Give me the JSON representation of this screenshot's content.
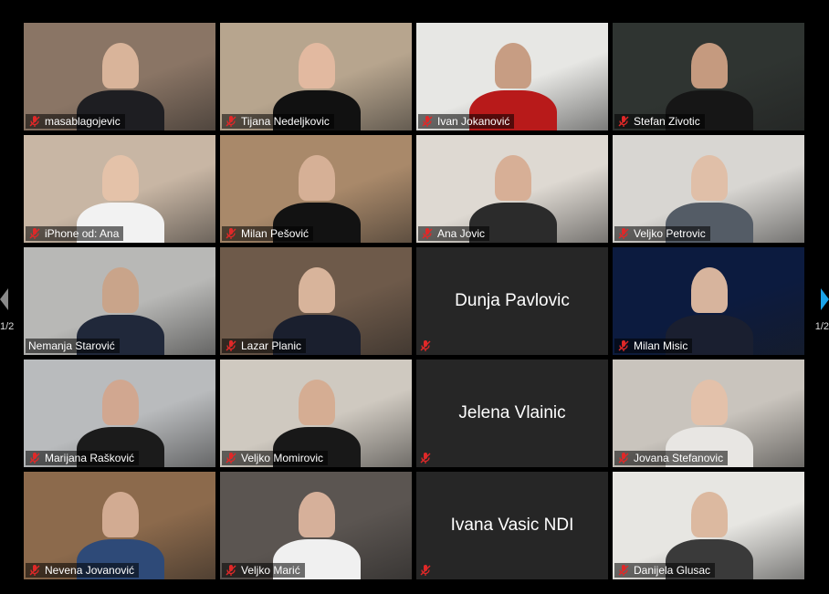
{
  "page_left": "1/2",
  "page_right": "1/2",
  "participants": [
    {
      "name": "masablagojevic",
      "bg": "#8a7565",
      "skin": "#d9b49a",
      "shirt": "#1e1e22",
      "muted": true
    },
    {
      "name": "Tijana Nedeljkovic",
      "bg": "#b7a58e",
      "skin": "#e2b9a0",
      "shirt": "#111111",
      "muted": true
    },
    {
      "name": "Ivan Jokanović",
      "bg": "#e7e7e4",
      "skin": "#c79d83",
      "shirt": "#b81a1a",
      "muted": true
    },
    {
      "name": "Stefan Zivotic",
      "bg": "#2f3431",
      "skin": "#c59a7f",
      "shirt": "#161616",
      "muted": true
    },
    {
      "name": "iPhone od: Ana",
      "bg": "#c8b6a4",
      "skin": "#e4c2a9",
      "shirt": "#f2f2f2",
      "muted": true
    },
    {
      "name": "Milan Pešović",
      "bg": "#a9896a",
      "skin": "#d6b096",
      "shirt": "#121212",
      "muted": true
    },
    {
      "name": "Ana Jovic",
      "bg": "#ded9d2",
      "skin": "#d7af96",
      "shirt": "#2b2b2b",
      "muted": true
    },
    {
      "name": "Veljko Petrovic",
      "bg": "#d8d6d2",
      "skin": "#e0bfa8",
      "shirt": "#545c66",
      "muted": true
    },
    {
      "name": "Nemanja Starović",
      "bg": "#b8b8b6",
      "skin": "#c9a48a",
      "shirt": "#20283a",
      "muted": false,
      "active": true
    },
    {
      "name": "Lazar Planic",
      "bg": "#6e5a4a",
      "skin": "#d8b49b",
      "shirt": "#1a1f2e",
      "muted": true
    },
    {
      "name": "Dunja Pavlovic",
      "nocam": true,
      "muted": true
    },
    {
      "name": "Milan Misic",
      "bg": "#0c1b3f",
      "skin": "#d7b49d",
      "shirt": "#1a1f30",
      "muted": true
    },
    {
      "name": "Marijana Rašković",
      "bg": "#b9bbbd",
      "skin": "#d1a790",
      "shirt": "#1b1b1b",
      "muted": true
    },
    {
      "name": "Veljko Momirovic",
      "bg": "#cfc9c0",
      "skin": "#d5ad93",
      "shirt": "#181818",
      "muted": true
    },
    {
      "name": "Jelena Vlainic",
      "nocam": true,
      "muted": true
    },
    {
      "name": "Jovana Stefanovic",
      "bg": "#c9c4bd",
      "skin": "#e3c1aa",
      "shirt": "#e8e6e3",
      "muted": true
    },
    {
      "name": "Nevena Jovanović",
      "bg": "#8c6a4c",
      "skin": "#d2ab92",
      "shirt": "#2e4a78",
      "muted": true
    },
    {
      "name": "Veljko Marić",
      "bg": "#5b5551",
      "skin": "#d6b09a",
      "shirt": "#f0f0f0",
      "muted": true
    },
    {
      "name": "Ivana Vasic NDI",
      "nocam": true,
      "muted": true
    },
    {
      "name": "Danijela Glusac",
      "bg": "#e7e6e2",
      "skin": "#dcb9a0",
      "shirt": "#3a3a3a",
      "muted": true
    }
  ]
}
